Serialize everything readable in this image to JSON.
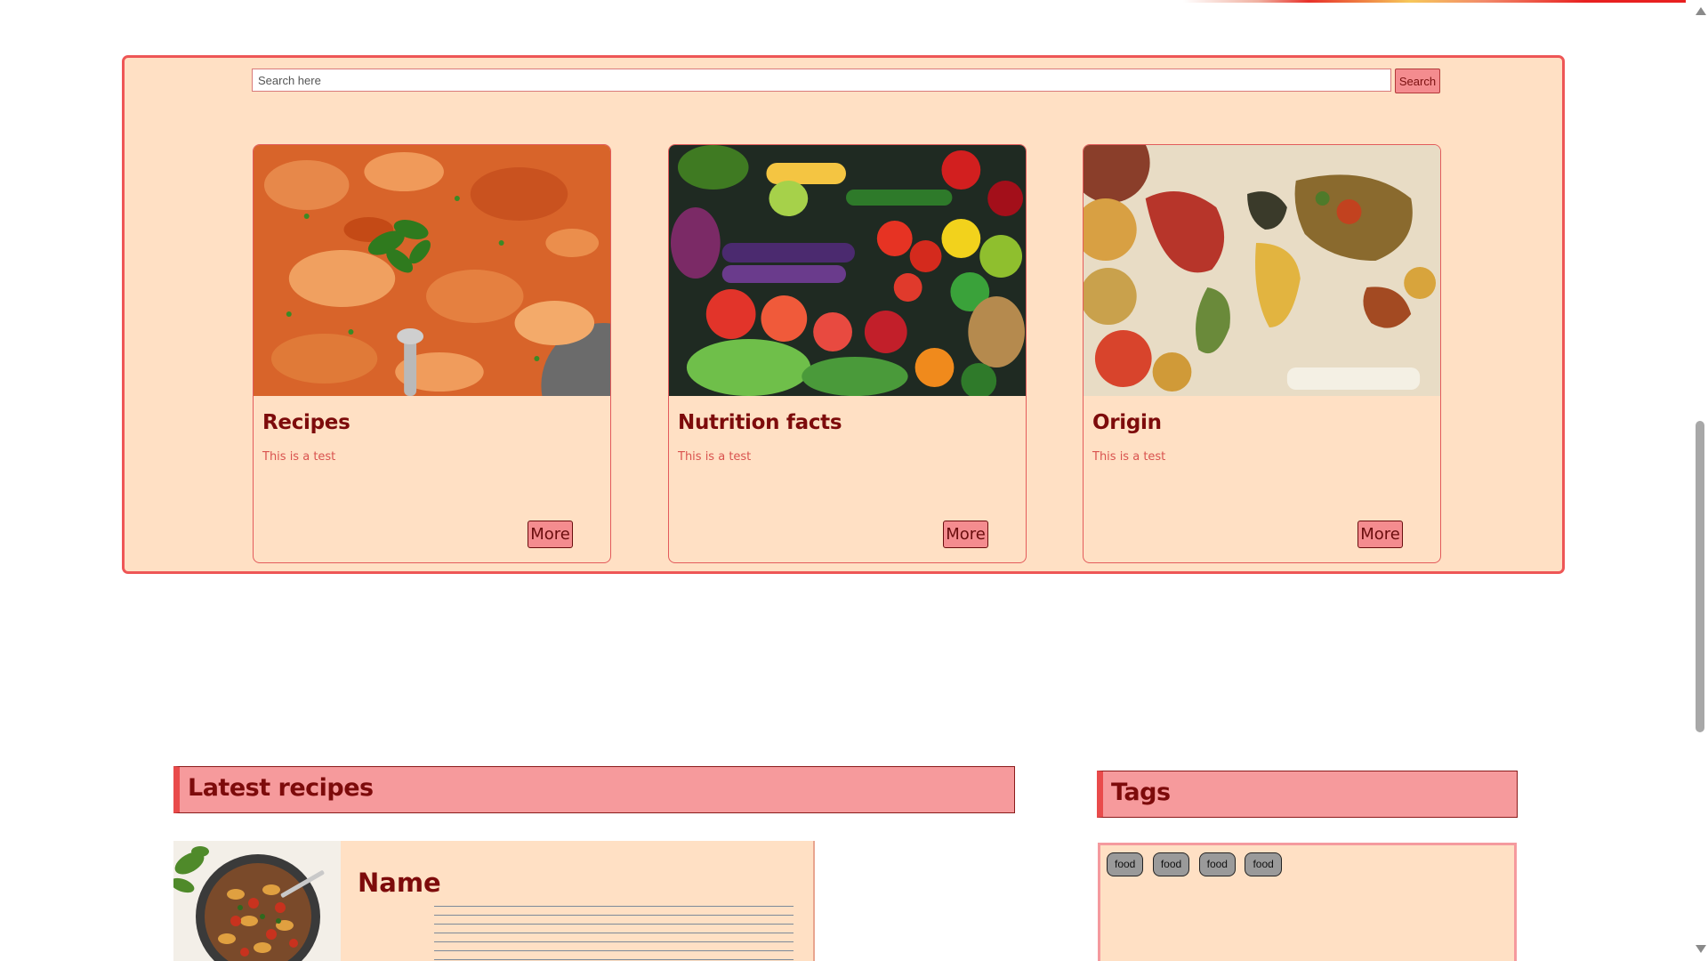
{
  "search": {
    "placeholder": "Search here",
    "button_label": "Search"
  },
  "cards": [
    {
      "title": "Recipes",
      "text": "This is a test",
      "button": "More",
      "image": "butter-chicken-curry"
    },
    {
      "title": "Nutrition facts",
      "text": "This is a test",
      "button": "More",
      "image": "assorted-vegetables-and-fruits"
    },
    {
      "title": "Origin",
      "text": "This is a test",
      "button": "More",
      "image": "spice-world-map"
    }
  ],
  "latest": {
    "heading": "Latest recipes",
    "items": [
      {
        "name": "Name",
        "image": "pasta-dish"
      }
    ]
  },
  "tags": {
    "heading": "Tags",
    "items": [
      "food",
      "food",
      "food",
      "food"
    ]
  },
  "colors": {
    "panel_bg": "#ffe0c4",
    "accent_border": "#ee5656",
    "heading_bg": "#f69a9c",
    "title_text": "#7d0b0b"
  }
}
